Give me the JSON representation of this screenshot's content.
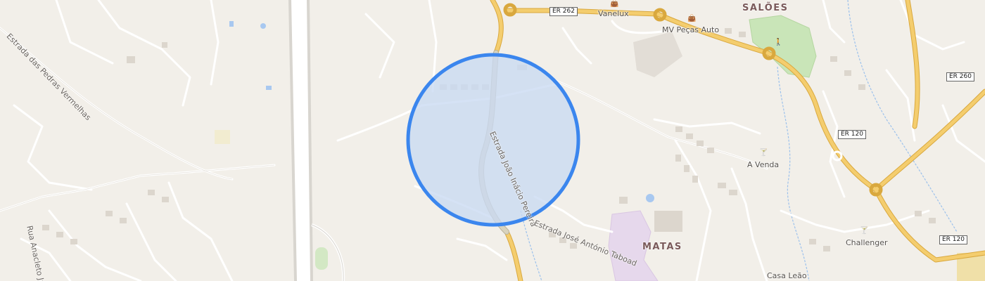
{
  "map": {
    "colors": {
      "land": "#f2efe9",
      "runway": "#ffffff",
      "primary_road": "#f2c96a",
      "minor_road": "#ffffff",
      "highlighted_road": "#d2cdb8",
      "park": "#c9e5b8",
      "commercial": "#e6d8ec",
      "water": "#a8c8f0",
      "accuracy_fill": "#c9daf2",
      "accuracy_stroke": "#3b86ee"
    },
    "places": {
      "saloes": "SALÕES",
      "matas": "MATAS"
    },
    "pois": {
      "vanelux": "Vanelux",
      "mv_pecas_auto": "MV Peças Auto",
      "a_venda": "A Venda",
      "challenger": "Challenger",
      "casa_leao": "Casa Leão"
    },
    "streets": {
      "pedras_vermelhas": "Estrada das Pedras Vermelhas",
      "joao_inacio": "Estrada João Inácio Pereira",
      "jose_antonio": "Estrada José António Taboad",
      "anacleto": "Rua Anacleto Já"
    },
    "route_shields": {
      "er262": "ER 262",
      "er260": "ER 260",
      "er120_a": "ER 120",
      "er120_b": "ER 120"
    },
    "icons": {
      "shop": "shopping-bag-icon",
      "bar": "cocktail-glass-icon",
      "park": "hiking-icon"
    }
  }
}
